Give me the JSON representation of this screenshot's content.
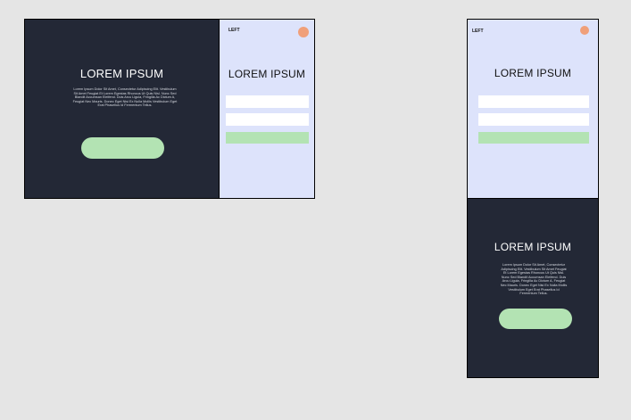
{
  "desktop": {
    "dark_panel": {
      "title": "LOREM IPSUM",
      "body": "Lorem Ipsum Dolor Sit Amet, Consectetur Adipiscing Elit. Vestibulum Sit Amet Feugiat Et Lorem Egestas Rhoncus Ut Quis Nisl. Nunc Sed Blandit Accumsan Eleifend. Duis Arcu Ligula, Fringilla Ac Dictum A, Feugiat Nec Mauris. Donec Eget Nisi Ex Nulla Mollis Vestibulum Eget Erat Phasellus Id Fermentum Tellus."
    },
    "light_panel": {
      "left_link": "LEFT",
      "title": "LOREM IPSUM"
    }
  },
  "mobile": {
    "light_panel": {
      "left_link": "LEFT",
      "title": "LOREM IPSUM"
    },
    "dark_panel": {
      "title": "LOREM IPSUM",
      "body": "Lorem Ipsum Dolor Sit Amet, Consectetur Adipiscing Elit. Vestibulum Sit Amet Feugiat Et Lorem Egestas Rhoncus Ut Quis Nisl. Nunc Sed Blandit Accumsan Eleifend. Duis Arcu Ligula, Fringilla Ac Dictum A, Feugiat Nec Mauris. Donec Eget Nisi Ex Nulla Mollis Vestibulum Eget Erat Phasellus Id Fermentum Tellus."
    }
  },
  "colors": {
    "background": "#e5e5e5",
    "dark_panel": "#232836",
    "light_panel": "#dde3fb",
    "accent_green": "#b3e3b3",
    "avatar": "#f0a07a",
    "field": "#ffffff"
  },
  "icons": {
    "avatar": "avatar-icon"
  }
}
